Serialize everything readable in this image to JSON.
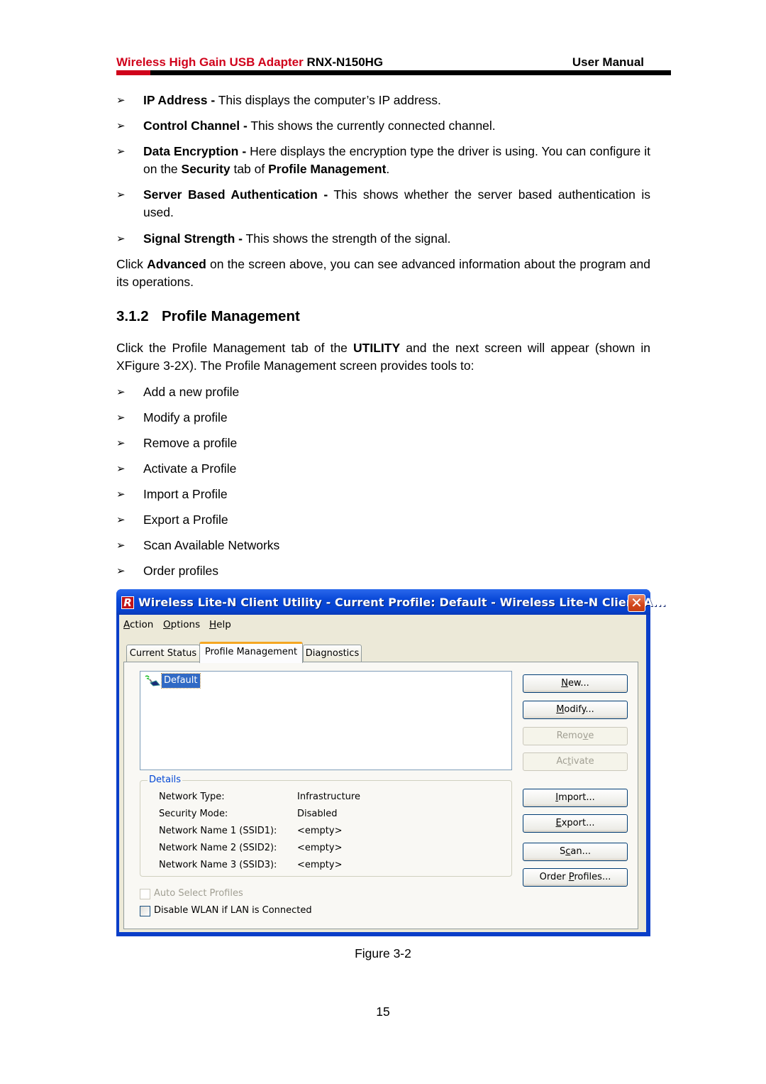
{
  "header": {
    "product": "Wireless High Gain USB Adapter",
    "model": "RNX-N150HG",
    "doc_type": "User Manual",
    "accent_color": "#d0021b"
  },
  "bullets_top": [
    {
      "term": "IP Address -",
      "text": " This displays the computer’s IP address."
    },
    {
      "term": "Control Channel -",
      "text": " This shows the currently connected channel."
    },
    {
      "term": "Data Encryption -",
      "text": " Here displays the encryption type the driver is using. You can configure it on the ",
      "b1": "Security",
      "mid": " tab of ",
      "b2": "Profile Management",
      "end": "."
    },
    {
      "term": "Server Based Authentication -",
      "text": " This shows whether the server based authentication is used."
    },
    {
      "term": "Signal Strength -",
      "text": " This shows the strength of the signal."
    }
  ],
  "advanced_para": {
    "pre": "Click ",
    "bold": "Advanced",
    "post": " on the screen above, you can see advanced information about the program and its operations."
  },
  "section": {
    "number": "3.1.2",
    "title": "Profile Management"
  },
  "intro_para": {
    "pre": "Click the Profile Management tab of the ",
    "bold": "UTILITY",
    "post": " and the next screen will appear (shown in XFigure 3-2X). The Profile Management screen provides tools to:"
  },
  "tools": [
    "Add a new profile",
    "Modify a profile",
    "Remove a profile",
    "Activate a Profile",
    "Import a Profile",
    "Export a Profile",
    "Scan Available Networks",
    "Order profiles"
  ],
  "window": {
    "title": "Wireless Lite-N Client Utility - Current Profile: Default - Wireless Lite-N Client A...",
    "logo_letter": "R",
    "close_glyph": "✕",
    "menu": [
      {
        "mnemonic": "A",
        "rest": "ction"
      },
      {
        "mnemonic": "O",
        "rest": "ptions"
      },
      {
        "mnemonic": "H",
        "rest": "elp"
      }
    ],
    "tabs": [
      {
        "label": "Current Status",
        "active": false
      },
      {
        "label": "Profile Management",
        "active": true
      },
      {
        "label": "Diagnostics",
        "active": false
      }
    ],
    "profiles": [
      {
        "name": "Default",
        "selected": true
      }
    ],
    "details": {
      "legend": "Details",
      "rows": [
        {
          "label": "Network Type:",
          "value": "Infrastructure"
        },
        {
          "label": "Security Mode:",
          "value": "Disabled"
        },
        {
          "label": "Network Name 1 (SSID1):",
          "value": "<empty>"
        },
        {
          "label": "Network Name 2 (SSID2):",
          "value": "<empty>"
        },
        {
          "label": "Network Name 3 (SSID3):",
          "value": "<empty>"
        }
      ]
    },
    "buttons": [
      {
        "pre": "",
        "mn": "N",
        "post": "ew...",
        "enabled": true
      },
      {
        "pre": "",
        "mn": "M",
        "post": "odify...",
        "enabled": true
      },
      {
        "pre": "Remo",
        "mn": "v",
        "post": "e",
        "enabled": false
      },
      {
        "pre": "Ac",
        "mn": "t",
        "post": "ivate",
        "enabled": false
      },
      {
        "pre": "",
        "mn": "I",
        "post": "mport...",
        "enabled": true
      },
      {
        "pre": "",
        "mn": "E",
        "post": "xport...",
        "enabled": true
      },
      {
        "pre": "S",
        "mn": "c",
        "post": "an...",
        "enabled": true
      },
      {
        "pre": "Order ",
        "mn": "P",
        "post": "rofiles...",
        "enabled": true
      }
    ],
    "checkboxes": [
      {
        "label": "Auto Select Profiles",
        "checked": false,
        "enabled": false
      },
      {
        "label": "Disable WLAN if LAN is Connected",
        "checked": false,
        "enabled": true
      }
    ]
  },
  "figure_caption": "Figure 3-2",
  "page_number": "15"
}
